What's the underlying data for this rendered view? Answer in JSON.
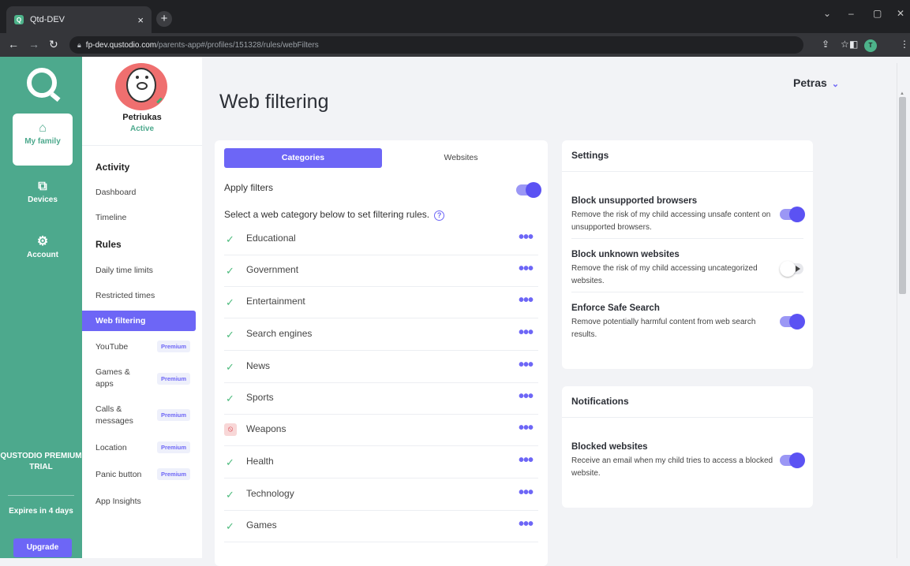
{
  "browser": {
    "tab_title": "Qtd-DEV",
    "tab_close": "×",
    "new_tab": "+",
    "favicon_letter": "Q",
    "url_host": "fp-dev.qustodio.com",
    "url_path": "/parents-app#/profiles/151328/rules/webFilters",
    "profile_initial": "T"
  },
  "leftnav": {
    "items": [
      {
        "label": "My family",
        "icon": "home-icon"
      },
      {
        "label": "Devices",
        "icon": "devices-icon"
      },
      {
        "label": "Account",
        "icon": "gear-icon"
      }
    ],
    "trial": "QUSTODIO PREMIUM TRIAL",
    "expires": "Expires in 4 days",
    "upgrade": "Upgrade"
  },
  "profile": {
    "name": "Petriukas",
    "status": "Active"
  },
  "sidebar": {
    "activity_title": "Activity",
    "rules_title": "Rules",
    "dashboard": "Dashboard",
    "timeline": "Timeline",
    "daily_time_limits": "Daily time limits",
    "restricted_times": "Restricted times",
    "web_filtering": "Web filtering",
    "youtube": "YouTube",
    "games_apps": "Games & apps",
    "calls_messages": "Calls & messages",
    "location": "Location",
    "panic_button": "Panic button",
    "app_insights": "App Insights",
    "premium_badge": "Premium"
  },
  "header": {
    "title": "Web filtering",
    "user": "Petras"
  },
  "filters": {
    "tab_categories": "Categories",
    "tab_websites": "Websites",
    "apply_filters": "Apply filters",
    "apply_filters_on": true,
    "select_label": "Select a web category below to set filtering rules.",
    "categories": [
      {
        "name": "Educational",
        "state": "allowed"
      },
      {
        "name": "Government",
        "state": "allowed"
      },
      {
        "name": "Entertainment",
        "state": "allowed"
      },
      {
        "name": "Search engines",
        "state": "allowed"
      },
      {
        "name": "News",
        "state": "allowed"
      },
      {
        "name": "Sports",
        "state": "allowed"
      },
      {
        "name": "Weapons",
        "state": "blocked"
      },
      {
        "name": "Health",
        "state": "allowed"
      },
      {
        "name": "Technology",
        "state": "allowed"
      },
      {
        "name": "Games",
        "state": "allowed"
      }
    ]
  },
  "settings": {
    "title": "Settings",
    "block_unsupported_title": "Block unsupported browsers",
    "block_unsupported_desc": "Remove the risk of my child accessing unsafe content on unsupported browsers.",
    "block_unsupported_on": true,
    "block_unknown_title": "Block unknown websites",
    "block_unknown_desc": "Remove the risk of my child accessing uncategorized websites.",
    "block_unknown_on": false,
    "safe_search_title": "Enforce Safe Search",
    "safe_search_desc": "Remove potentially harmful content from web search results.",
    "safe_search_on": true
  },
  "notifications": {
    "title": "Notifications",
    "blocked_title": "Blocked websites",
    "blocked_desc": "Receive an email when my child tries to access a blocked website.",
    "blocked_on": true
  },
  "colors": {
    "brand_green": "#4da98d",
    "accent_purple": "#6d66f6",
    "allowed_green": "#4dbb7d",
    "blocked_red": "#d8404a"
  }
}
